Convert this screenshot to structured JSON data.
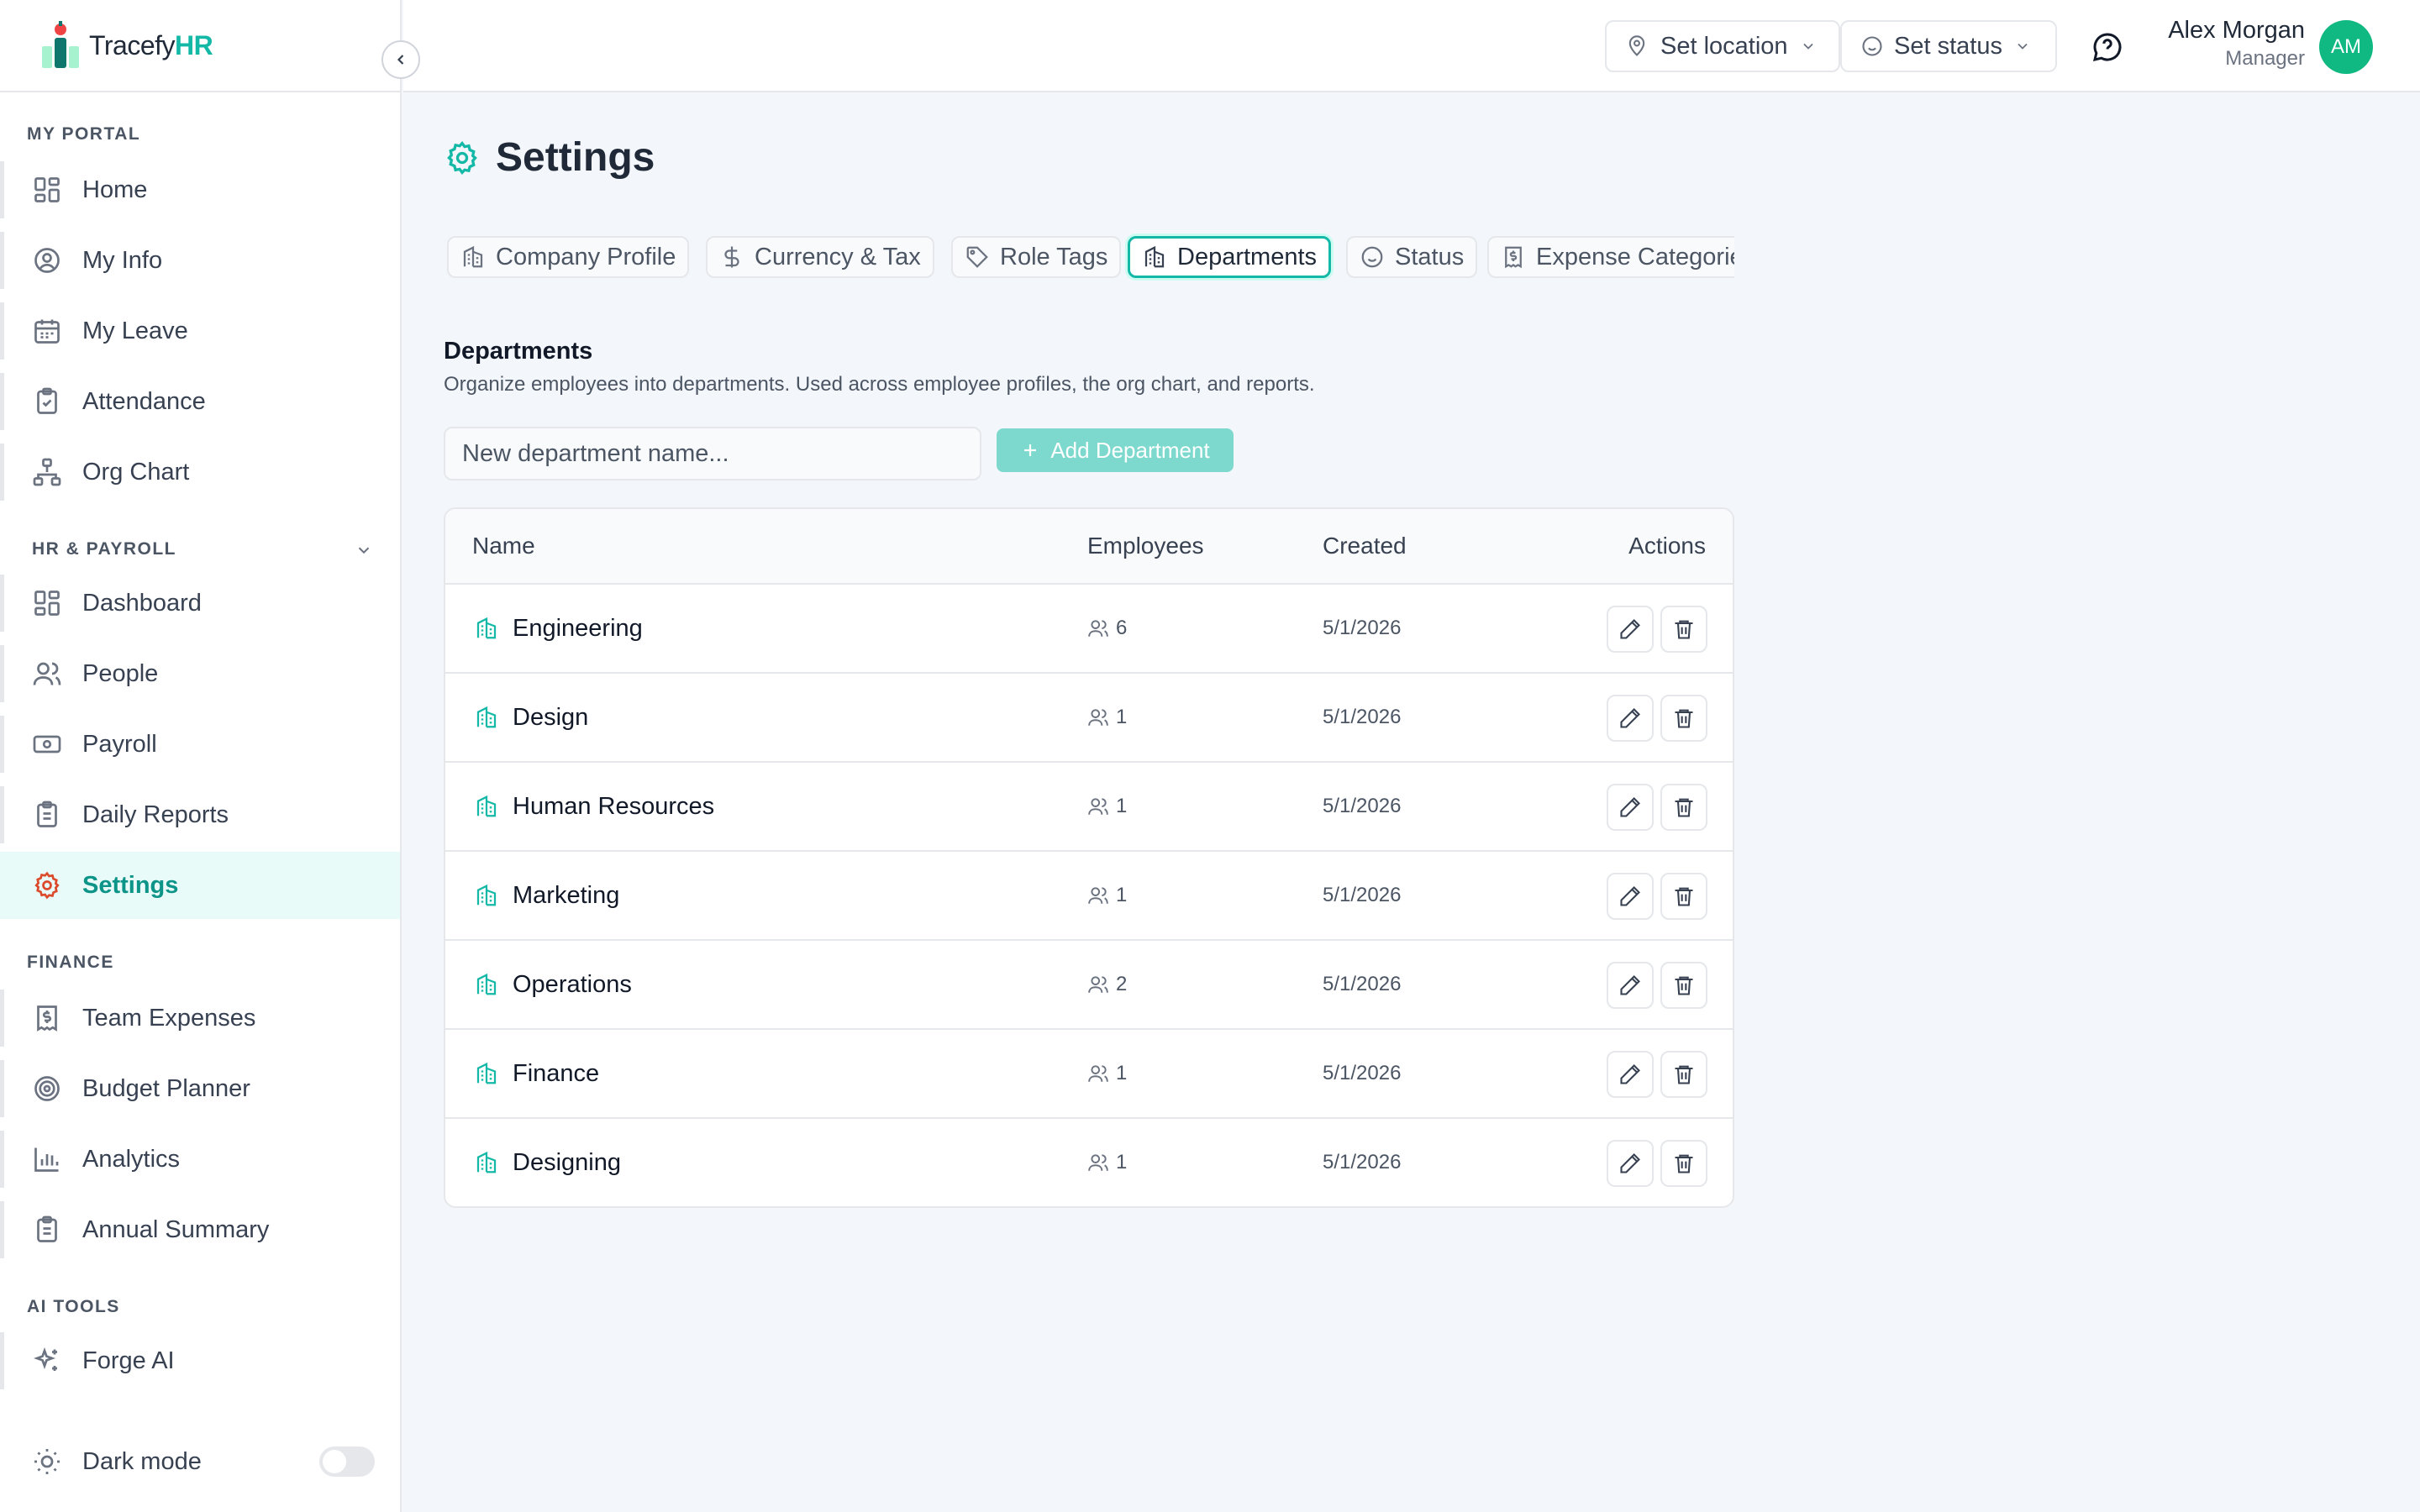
{
  "brand": {
    "name": "Tracefy",
    "accent": "HR"
  },
  "sidebar": {
    "sections": [
      {
        "label": "MY PORTAL"
      },
      {
        "label": "HR & PAYROLL"
      },
      {
        "label": "FINANCE"
      },
      {
        "label": "AI TOOLS"
      }
    ],
    "items": [
      {
        "label": "Home",
        "icon": "grid-icon"
      },
      {
        "label": "My Info",
        "icon": "user-circle-icon"
      },
      {
        "label": "My Leave",
        "icon": "calendar-icon"
      },
      {
        "label": "Attendance",
        "icon": "clipboard-check-icon"
      },
      {
        "label": "Org Chart",
        "icon": "org-chart-icon"
      },
      {
        "label": "Dashboard",
        "icon": "grid-icon"
      },
      {
        "label": "People",
        "icon": "users-icon"
      },
      {
        "label": "Payroll",
        "icon": "banknote-icon"
      },
      {
        "label": "Daily Reports",
        "icon": "clipboard-list-icon"
      },
      {
        "label": "Settings",
        "icon": "gear-icon",
        "active": true
      },
      {
        "label": "Team Expenses",
        "icon": "receipt-icon"
      },
      {
        "label": "Budget Planner",
        "icon": "target-icon"
      },
      {
        "label": "Analytics",
        "icon": "bar-chart-icon"
      },
      {
        "label": "Annual Summary",
        "icon": "clipboard-list-icon"
      },
      {
        "label": "Forge AI",
        "icon": "sparkles-icon"
      }
    ],
    "dark_mode_label": "Dark mode",
    "dark_mode_on": false
  },
  "topbar": {
    "location_label": "Set location",
    "status_label": "Set status",
    "user_name": "Alex Morgan",
    "user_role": "Manager",
    "avatar_initials": "AM"
  },
  "page": {
    "title": "Settings"
  },
  "tabs": [
    {
      "label": "Company Profile",
      "icon": "building-icon"
    },
    {
      "label": "Currency & Tax",
      "icon": "dollar-icon"
    },
    {
      "label": "Role Tags",
      "icon": "tag-icon"
    },
    {
      "label": "Departments",
      "icon": "building-icon",
      "active": true
    },
    {
      "label": "Status",
      "icon": "smile-icon"
    },
    {
      "label": "Expense Categories",
      "icon": "receipt-icon"
    }
  ],
  "departments": {
    "title": "Departments",
    "description": "Organize employees into departments. Used across employee profiles, the org chart, and reports.",
    "input_placeholder": "New department name...",
    "add_button_label": "Add Department",
    "columns": {
      "name": "Name",
      "employees": "Employees",
      "created": "Created",
      "actions": "Actions"
    },
    "rows": [
      {
        "name": "Engineering",
        "employees": "6",
        "created": "5/1/2026"
      },
      {
        "name": "Design",
        "employees": "1",
        "created": "5/1/2026"
      },
      {
        "name": "Human Resources",
        "employees": "1",
        "created": "5/1/2026"
      },
      {
        "name": "Marketing",
        "employees": "1",
        "created": "5/1/2026"
      },
      {
        "name": "Operations",
        "employees": "2",
        "created": "5/1/2026"
      },
      {
        "name": "Finance",
        "employees": "1",
        "created": "5/1/2026"
      },
      {
        "name": "Designing",
        "employees": "1",
        "created": "5/1/2026"
      }
    ]
  },
  "colors": {
    "accent": "#14b8a6",
    "active_bg": "#e8fbf8",
    "avatar": "#10b981",
    "add_button": "#7dd9cd"
  }
}
